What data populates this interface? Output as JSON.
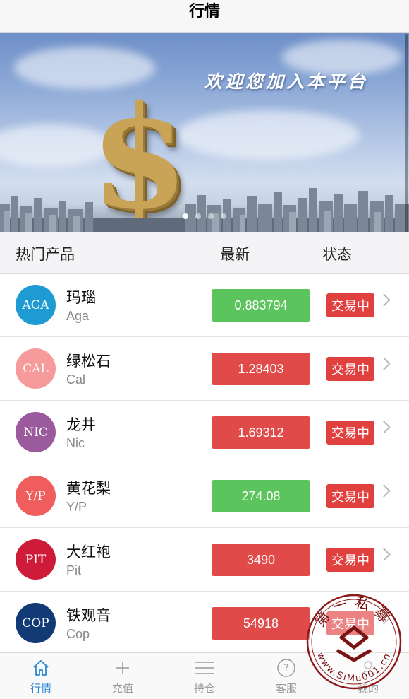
{
  "header": {
    "title": "行情"
  },
  "banner": {
    "slogan": "欢迎您加入本平台",
    "symbol": "$",
    "carousel": {
      "count": 4,
      "active": 0
    }
  },
  "list_header": {
    "col_product": "热门产品",
    "col_latest": "最新",
    "col_status": "状态"
  },
  "products": [
    {
      "name": "玛瑙",
      "code": "Aga",
      "badge": "AGA",
      "badge_color": "#1f9bd3",
      "price": "0.883794",
      "trend": "up",
      "status": "交易中"
    },
    {
      "name": "绿松石",
      "code": "Cal",
      "badge": "CAL",
      "badge_color": "#f79a9c",
      "price": "1.28403",
      "trend": "down",
      "status": "交易中"
    },
    {
      "name": "龙井",
      "code": "Nic",
      "badge": "NIC",
      "badge_color": "#9a5a9c",
      "price": "1.69312",
      "trend": "down",
      "status": "交易中"
    },
    {
      "name": "黄花梨",
      "code": "Y/P",
      "badge": "Y/P",
      "badge_color": "#f05d5d",
      "price": "274.08",
      "trend": "up",
      "status": "交易中"
    },
    {
      "name": "大红袍",
      "code": "Pit",
      "badge": "PIT",
      "badge_color": "#cf1b3a",
      "price": "3490",
      "trend": "down",
      "status": "交易中"
    },
    {
      "name": "铁观音",
      "code": "Cop",
      "badge": "COP",
      "badge_color": "#123a75",
      "price": "54918",
      "trend": "down",
      "status": "交易中"
    }
  ],
  "colors": {
    "up": "#5cc45c",
    "down": "#e04a48",
    "status": "#e0413f",
    "tab_active": "#2a86d6"
  },
  "tabs": [
    {
      "label": "行情",
      "icon": "home-icon",
      "active": true
    },
    {
      "label": "充值",
      "icon": "plus-icon",
      "active": false
    },
    {
      "label": "持仓",
      "icon": "menu-icon",
      "active": false
    },
    {
      "label": "客服",
      "icon": "help-icon",
      "active": false
    },
    {
      "label": "我的",
      "icon": "user-icon",
      "active": false
    }
  ],
  "watermark": {
    "text_top": "第一私募",
    "text_bottom": "www.SiMu001.cn"
  }
}
